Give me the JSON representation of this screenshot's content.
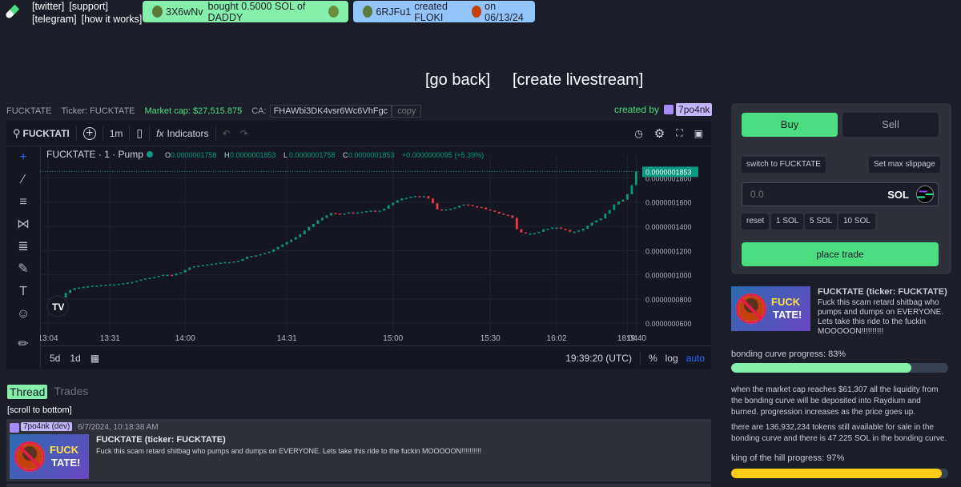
{
  "header": {
    "links_row1": [
      "[twitter]",
      "[support]"
    ],
    "links_row2": [
      "[telegram]",
      "[how it works]"
    ],
    "banner_buy": {
      "user": "3X6wNv",
      "text": "bought 0.5000 SOL of DADDY",
      "color": "#86efac"
    },
    "banner_create": {
      "user": "6RJFu1",
      "text": "created FLOKI",
      "date": "on 06/13/24",
      "color": "#93c5fd"
    },
    "nav": {
      "go_back": "[go back]",
      "create_livestream": "[create livestream]"
    }
  },
  "token": {
    "name": "FUCKTATE",
    "ticker_label": "Ticker: FUCKTATE",
    "market_cap": "Market cap: $27,515.875",
    "ca_label": "CA:",
    "ca_value": "FHAWbi3DK4vsr6Wc6VhFgc",
    "copy": "copy",
    "created_by": "created by",
    "creator": "7po4nk"
  },
  "chart_toolbar": {
    "symbol": "FUCKTATI",
    "interval": "1m",
    "indicators": "Indicators"
  },
  "chart_data": {
    "type": "candlestick",
    "title": "FUCKTATE · 1 · Pump",
    "ohlc_label": {
      "O": "0.0000001758",
      "H": "0.0000001853",
      "L": "0.0000001758",
      "C": "0.0000001853",
      "change": "+0.0000000095 (+5.39%)"
    },
    "last_price": "0.0000001853",
    "y_ticks": [
      "0.0000001800",
      "0.0000001600",
      "0.0000001400",
      "0.0000001200",
      "0.0000001000",
      "0.0000000800",
      "0.0000000600"
    ],
    "y_tick_values": [
      1.8e-07,
      1.6e-07,
      1.4e-07,
      1.2e-07,
      1e-07,
      8e-08,
      6e-08
    ],
    "ylim": [
      5.75e-08,
      1.915e-07
    ],
    "x_ticks": [
      "13:04",
      "13:31",
      "14:00",
      "14:31",
      "15:00",
      "15:30",
      "16:02",
      "18:04",
      "19:40"
    ],
    "closes": [
      7.35e-08,
      7.95e-08,
      8.1e-08,
      8.12e-08,
      8.5e-08,
      8.75e-08,
      8.9e-08,
      8.95e-08,
      9e-08,
      9.05e-08,
      9.1e-08,
      9.1e-08,
      9.15e-08,
      9.18e-08,
      9.2e-08,
      9.2e-08,
      9.25e-08,
      9.3e-08,
      9.35e-08,
      9.4e-08,
      9.5e-08,
      9.6e-08,
      9.7e-08,
      9.75e-08,
      9.8e-08,
      9.9e-08,
      1e-07,
      1e-07,
      9.95e-08,
      1.01e-07,
      1.02e-07,
      1.04e-07,
      1.06e-07,
      1.07e-07,
      1.075e-07,
      1.08e-07,
      1.085e-07,
      1.09e-07,
      1.095e-07,
      1.1e-07,
      1.105e-07,
      1.105e-07,
      1.11e-07,
      1.115e-07,
      1.13e-07,
      1.15e-07,
      1.155e-07,
      1.16e-07,
      1.17e-07,
      1.18e-07,
      1.19e-07,
      1.21e-07,
      1.23e-07,
      1.25e-07,
      1.27e-07,
      1.29e-07,
      1.31e-07,
      1.335e-07,
      1.365e-07,
      1.395e-07,
      1.42e-07,
      1.45e-07,
      1.47e-07,
      1.49e-07,
      1.51e-07,
      1.505e-07,
      1.495e-07,
      1.505e-07,
      1.515e-07,
      1.505e-07,
      1.515e-07,
      1.52e-07,
      1.525e-07,
      1.53e-07,
      1.525e-07,
      1.53e-07,
      1.545e-07,
      1.575e-07,
      1.595e-07,
      1.615e-07,
      1.63e-07,
      1.635e-07,
      1.645e-07,
      1.65e-07,
      1.645e-07,
      1.65e-07,
      1.63e-07,
      1.59e-07,
      1.54e-07,
      1.535e-07,
      1.54e-07,
      1.545e-07,
      1.555e-07,
      1.57e-07,
      1.58e-07,
      1.575e-07,
      1.565e-07,
      1.56e-07,
      1.555e-07,
      1.54e-07,
      1.53e-07,
      1.52e-07,
      1.505e-07,
      1.495e-07,
      1.49e-07,
      1.47e-07,
      1.375e-07,
      1.35e-07,
      1.34e-07,
      1.34e-07,
      1.345e-07,
      1.355e-07,
      1.375e-07,
      1.38e-07,
      1.39e-07,
      1.39e-07,
      1.38e-07,
      1.37e-07,
      1.355e-07,
      1.355e-07,
      1.365e-07,
      1.38e-07,
      1.405e-07,
      1.43e-07,
      1.45e-07,
      1.465e-07,
      1.505e-07,
      1.535e-07,
      1.58e-07,
      1.605e-07,
      1.62e-07,
      1.665e-07,
      1.74e-07,
      1.853e-07
    ],
    "time": "19:39:20 (UTC)",
    "range_buttons": [
      "5d",
      "1d"
    ],
    "scale_buttons": [
      "%",
      "log",
      "auto"
    ]
  },
  "trade": {
    "buy": "Buy",
    "sell": "Sell",
    "switch": "switch to FUCKTATE",
    "slippage": "Set max slippage",
    "amount_placeholder": "0.0",
    "currency": "SOL",
    "presets": [
      "reset",
      "1 SOL",
      "5 SOL",
      "10 SOL"
    ],
    "place": "place trade"
  },
  "token_card": {
    "title": "FUCKTATE (ticker: FUCKTATE)",
    "description": "Fuck this scam retard shitbag who pumps and dumps on EVERYONE. Lets take this ride to the fuckin MOOOOON!!!!!!!!!!",
    "image_text_line1": "FUCK",
    "image_text_line2": "TATE!"
  },
  "bonding": {
    "label": "bonding curve progress: 83%",
    "progress": 0.83,
    "note1": "when the market cap reaches $61,307 all the liquidity from the bonding curve will be deposited into Raydium and burned. progression increases as the price goes up.",
    "note2": "there are 136,932,234 tokens still available for sale in the bonding curve and there is 47.225 SOL in the bonding curve."
  },
  "koth": {
    "label": "king of the hill progress: 97%",
    "progress": 0.97
  },
  "thread": {
    "tab_thread": "Thread",
    "tab_trades": "Trades",
    "scroll": "[scroll to bottom]",
    "post": {
      "user": "7po4nk (dev)",
      "date": "6/7/2024, 10:18:38 AM",
      "title": "FUCKTATE (ticker: FUCKTATE)",
      "body": "Fuck this scam retard shitbag who pumps and dumps on EVERYONE. Lets take this ride to the fuckin MOOOOON!!!!!!!!!!"
    }
  },
  "colors": {
    "green": "#4ade80",
    "red": "#f23645",
    "candle_up": "#089981",
    "bg": "#1b1d28",
    "panel": "#2e303a",
    "koth": "#facc15"
  }
}
